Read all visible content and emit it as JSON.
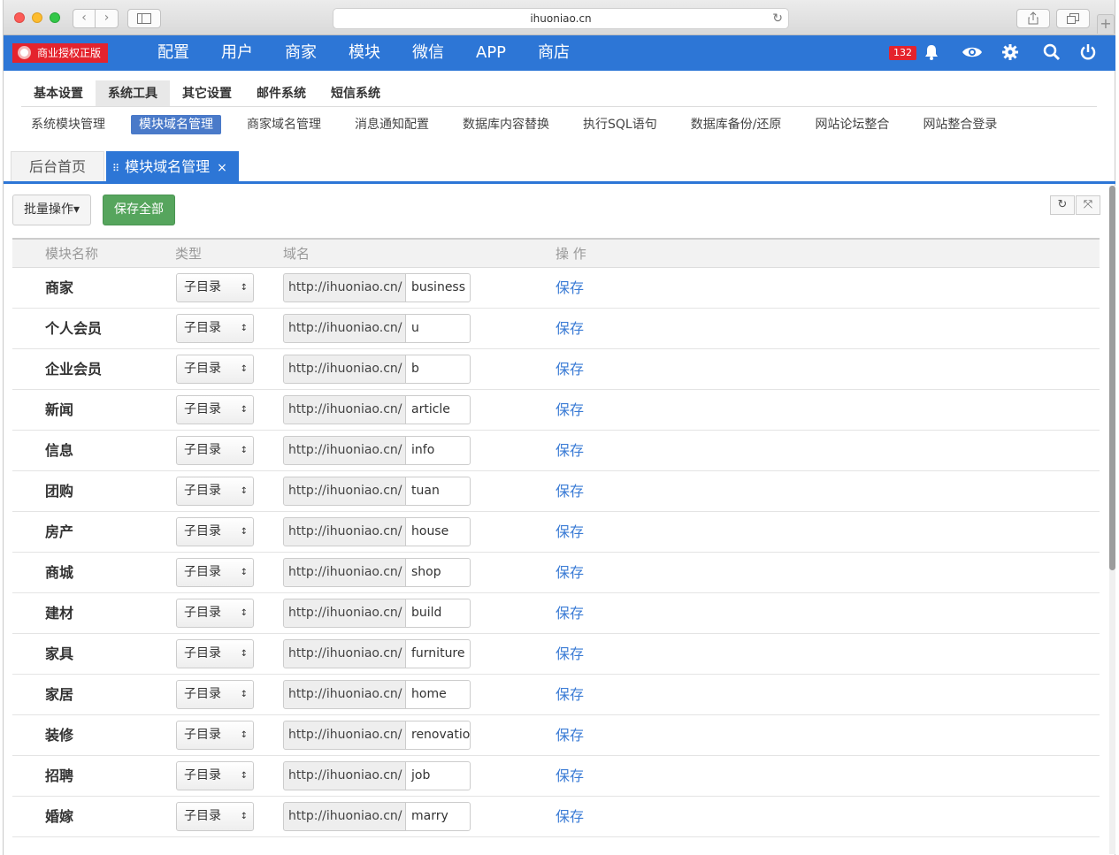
{
  "browser": {
    "url": "ihuoniao.cn",
    "back": "‹",
    "fwd": "›",
    "reload": "↻",
    "plus": "+"
  },
  "topnav": {
    "brand": "商业授权正版",
    "menu": [
      "配置",
      "用户",
      "商家",
      "模块",
      "微信",
      "APP",
      "商店"
    ],
    "notifications": "132",
    "icons": [
      "bell-icon",
      "eye-icon",
      "gear-icon",
      "search-icon",
      "power-icon"
    ]
  },
  "subtabs": [
    "基本设置",
    "系统工具",
    "其它设置",
    "邮件系统",
    "短信系统"
  ],
  "links": [
    "系统模块管理",
    "模块域名管理",
    "商家域名管理",
    "消息通知配置",
    "数据库内容替换",
    "执行SQL语句",
    "数据库备份/还原",
    "网站论坛整合",
    "网站整合登录"
  ],
  "pagetabs": {
    "home": "后台首页",
    "current": "模块域名管理",
    "close": "×"
  },
  "toolbar": {
    "batch": "批量操作▾",
    "save_all": "保存全部"
  },
  "table": {
    "headers": [
      "模块名称",
      "类型",
      "域名",
      "操 作"
    ],
    "prefix": "http://ihuoniao.cn/",
    "type": "子目录",
    "op": "保存",
    "rows": [
      {
        "name": "商家",
        "domain": "business"
      },
      {
        "name": "个人会员",
        "domain": "u"
      },
      {
        "name": "企业会员",
        "domain": "b"
      },
      {
        "name": "新闻",
        "domain": "article"
      },
      {
        "name": "信息",
        "domain": "info"
      },
      {
        "name": "团购",
        "domain": "tuan"
      },
      {
        "name": "房产",
        "domain": "house"
      },
      {
        "name": "商城",
        "domain": "shop"
      },
      {
        "name": "建材",
        "domain": "build"
      },
      {
        "name": "家具",
        "domain": "furniture"
      },
      {
        "name": "家居",
        "domain": "home"
      },
      {
        "name": "装修",
        "domain": "renovation"
      },
      {
        "name": "招聘",
        "domain": "job"
      },
      {
        "name": "婚嫁",
        "domain": "marry"
      }
    ]
  }
}
